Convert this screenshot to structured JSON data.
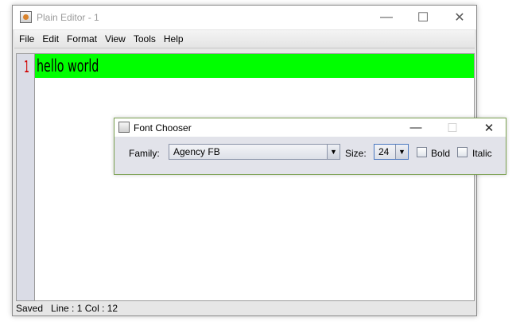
{
  "window": {
    "title": "Plain Editor - 1",
    "controls": {
      "minimize": "—",
      "maximize": "☐",
      "close": "✕"
    }
  },
  "menubar": {
    "items": [
      "File",
      "Edit",
      "Format",
      "View",
      "Tools",
      "Help"
    ]
  },
  "editor": {
    "line_number": "1",
    "line_text": "hello world",
    "highlight_color": "#00ff00",
    "line_number_color": "#d00000"
  },
  "status": {
    "text": "Saved   Line : 1 Col : 12"
  },
  "font_chooser": {
    "title": "Font Chooser",
    "controls": {
      "minimize": "—",
      "maximize": "☐",
      "close": "✕"
    },
    "family_label": "Family:",
    "family_value": "Agency FB",
    "size_label": "Size:",
    "size_value": "24",
    "bold_label": "Bold",
    "italic_label": "Italic",
    "bold_checked": false,
    "italic_checked": false
  }
}
